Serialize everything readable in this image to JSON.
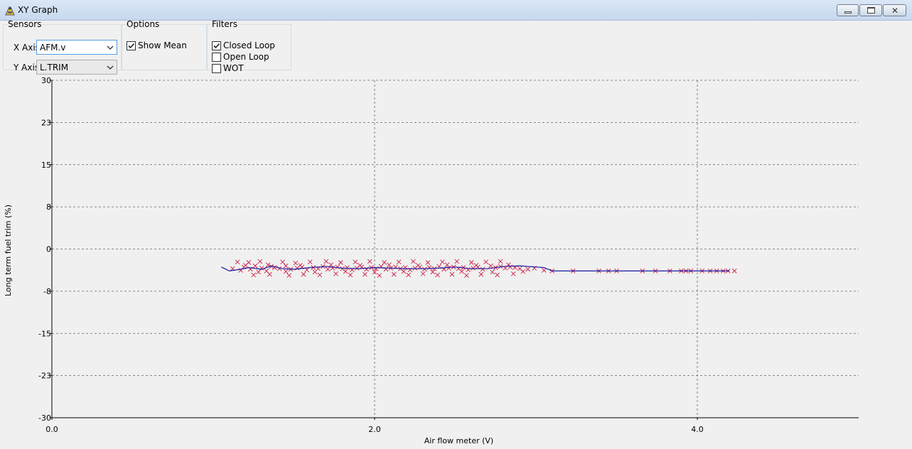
{
  "window": {
    "title": "XY Graph",
    "icon": "graph-app-icon"
  },
  "sensors": {
    "legend": "Sensors",
    "x_axis_label": "X Axis",
    "x_axis_value": "AFM.v",
    "y_axis_label": "Y Axis",
    "y_axis_value": "L.TRIM"
  },
  "options": {
    "legend": "Options",
    "show_mean_label": "Show Mean",
    "show_mean_checked": true
  },
  "filters": {
    "legend": "Filters",
    "items": [
      {
        "label": "Closed Loop",
        "checked": true
      },
      {
        "label": "Open Loop",
        "checked": false
      },
      {
        "label": "WOT",
        "checked": false
      }
    ]
  },
  "chart_data": {
    "type": "scatter",
    "xlabel": "Air flow meter (V)",
    "ylabel": "Long term fuel trim (%)",
    "xlim": [
      0,
      5
    ],
    "ylim": [
      -30,
      30
    ],
    "x_ticks": [
      0,
      2,
      4
    ],
    "x_tick_labels": [
      "0.0",
      "2.0",
      "4.0"
    ],
    "y_ticks": [
      30,
      22.5,
      15,
      7.5,
      0,
      -7.5,
      -15,
      -22.5,
      -30
    ],
    "y_tick_labels": [
      "30",
      "23",
      "15",
      "8",
      "0",
      "-8",
      "-15",
      "-23",
      "-30"
    ],
    "grid": true,
    "series": [
      {
        "marker": "x",
        "color": "#cc2a4a",
        "x": [
          1.12,
          1.17,
          1.19,
          1.23,
          1.26,
          1.3,
          1.33,
          1.36,
          1.38,
          1.41,
          1.45,
          1.48,
          1.52,
          1.55,
          1.58,
          1.62,
          1.65,
          1.68,
          1.71,
          1.74,
          1.77,
          1.8,
          1.83,
          1.86,
          1.89,
          1.92,
          1.95,
          1.98,
          2.01,
          2.04,
          2.07,
          2.1,
          2.13,
          2.16,
          2.19,
          2.22,
          2.25,
          2.28,
          2.31,
          2.34,
          2.37,
          2.4,
          2.43,
          2.46,
          2.49,
          2.52,
          2.55,
          2.58,
          2.61,
          2.64,
          2.67,
          2.72,
          2.75,
          2.78,
          2.81,
          2.84,
          2.87,
          2.9,
          2.95,
          2.99,
          3.05,
          3.1,
          3.23,
          3.39,
          3.45,
          3.5,
          3.66,
          3.74,
          3.83,
          3.9,
          3.93,
          3.96,
          4.03,
          4.08,
          4.12,
          4.16,
          4.19,
          4.23,
          1.15,
          1.22,
          1.29,
          1.43,
          1.51,
          1.6,
          1.7,
          1.79,
          1.88,
          1.97,
          2.06,
          2.15,
          2.24,
          2.33,
          2.42,
          2.51,
          2.6,
          2.69,
          2.78,
          1.25,
          1.35,
          1.47,
          1.56,
          1.66,
          1.76,
          1.85,
          1.94,
          2.03,
          2.12,
          2.21,
          2.3,
          2.39,
          2.48,
          2.57,
          2.66,
          2.76,
          2.86,
          1.2,
          1.28,
          1.34,
          1.45,
          1.54,
          1.63,
          1.73,
          1.82,
          1.91,
          2.0,
          2.09,
          2.18,
          2.27,
          2.36,
          2.45,
          2.54,
          2.63,
          2.73,
          2.83,
          2.92
        ],
        "y": [
          -3.5,
          -3.8,
          -3.2,
          -3.6,
          -3.0,
          -3.4,
          -3.9,
          -3.1,
          -3.3,
          -3.5,
          -3.0,
          -3.6,
          -3.4,
          -3.2,
          -3.7,
          -3.3,
          -3.5,
          -3.1,
          -3.6,
          -3.4,
          -3.2,
          -3.5,
          -3.3,
          -3.7,
          -3.4,
          -3.2,
          -3.6,
          -3.3,
          -3.5,
          -3.1,
          -3.6,
          -3.4,
          -3.2,
          -3.5,
          -3.3,
          -3.7,
          -3.4,
          -3.2,
          -3.6,
          -3.3,
          -3.5,
          -3.1,
          -3.6,
          -3.4,
          -3.2,
          -3.5,
          -3.3,
          -3.7,
          -3.4,
          -3.2,
          -3.6,
          -3.0,
          -3.3,
          -3.1,
          -3.4,
          -3.2,
          -3.3,
          -3.5,
          -3.6,
          -3.4,
          -3.8,
          -3.9,
          -3.9,
          -3.9,
          -3.9,
          -3.9,
          -3.9,
          -3.9,
          -3.9,
          -3.9,
          -3.9,
          -3.9,
          -3.9,
          -3.9,
          -3.9,
          -3.9,
          -3.9,
          -3.9,
          -2.3,
          -2.4,
          -2.2,
          -2.3,
          -2.5,
          -2.3,
          -2.2,
          -2.4,
          -2.3,
          -2.2,
          -2.4,
          -2.3,
          -2.2,
          -2.4,
          -2.3,
          -2.2,
          -2.4,
          -2.3,
          -2.2,
          -4.6,
          -4.5,
          -4.7,
          -4.5,
          -4.6,
          -4.4,
          -4.6,
          -4.5,
          -4.7,
          -4.5,
          -4.6,
          -4.4,
          -4.6,
          -4.5,
          -4.7,
          -4.5,
          -4.6,
          -4.4,
          -2.9,
          -4.1,
          -2.8,
          -4.0,
          -2.9,
          -4.1,
          -2.8,
          -4.0,
          -2.9,
          -4.1,
          -2.8,
          -4.0,
          -2.9,
          -4.1,
          -2.8,
          -4.0,
          -2.9,
          -4.1,
          -2.8,
          -4.0
        ]
      },
      {
        "marker": "line",
        "color": "#1a1aa6",
        "x": [
          1.05,
          1.1,
          1.17,
          1.22,
          1.3,
          1.36,
          1.43,
          1.5,
          1.6,
          1.7,
          1.8,
          1.9,
          2.0,
          2.1,
          2.2,
          2.3,
          2.4,
          2.5,
          2.6,
          2.7,
          2.8,
          2.9,
          3.0,
          3.05,
          3.1,
          3.3,
          3.6,
          3.9,
          4.2
        ],
        "y": [
          -3.2,
          -3.9,
          -3.6,
          -3.3,
          -3.6,
          -3.0,
          -3.5,
          -3.6,
          -3.3,
          -3.1,
          -3.4,
          -3.5,
          -3.3,
          -3.4,
          -3.5,
          -3.5,
          -3.4,
          -3.2,
          -3.5,
          -3.5,
          -3.1,
          -3.0,
          -3.2,
          -3.3,
          -3.9,
          -3.9,
          -3.9,
          -3.9,
          -3.9
        ]
      }
    ]
  }
}
